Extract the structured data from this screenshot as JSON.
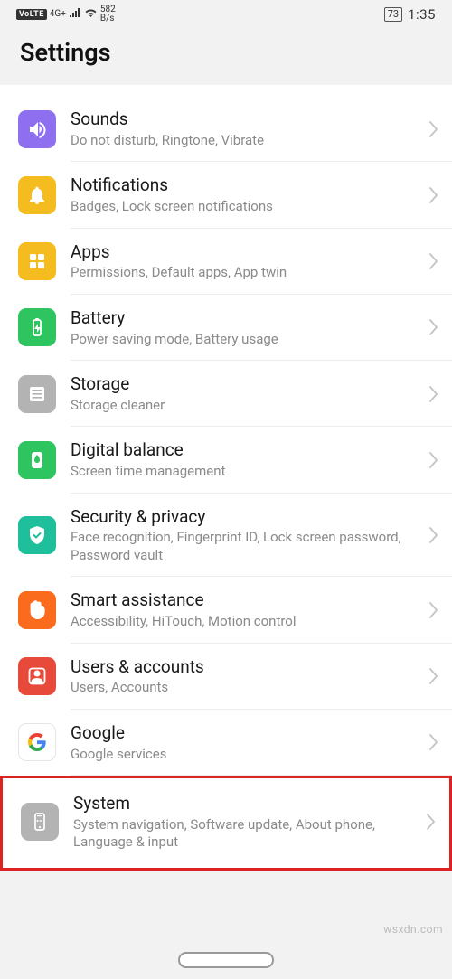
{
  "status": {
    "volte": "VoLTE",
    "network": "4G+",
    "speed_value": "582",
    "speed_unit": "B/s",
    "battery": "73",
    "time": "1:35"
  },
  "header": {
    "title": "Settings"
  },
  "items": [
    {
      "icon": "sounds",
      "icon_cls": "ic-purple",
      "title": "Sounds",
      "subtitle": "Do not disturb, Ringtone, Vibrate"
    },
    {
      "icon": "notifications",
      "icon_cls": "ic-yellow",
      "title": "Notifications",
      "subtitle": "Badges, Lock screen notifications"
    },
    {
      "icon": "apps",
      "icon_cls": "ic-yellow",
      "title": "Apps",
      "subtitle": "Permissions, Default apps, App twin"
    },
    {
      "icon": "battery",
      "icon_cls": "ic-green",
      "title": "Battery",
      "subtitle": "Power saving mode, Battery usage"
    },
    {
      "icon": "storage",
      "icon_cls": "ic-gray",
      "title": "Storage",
      "subtitle": "Storage cleaner"
    },
    {
      "icon": "digital-balance",
      "icon_cls": "ic-green",
      "title": "Digital balance",
      "subtitle": "Screen time management"
    },
    {
      "icon": "security",
      "icon_cls": "ic-teal",
      "title": "Security & privacy",
      "subtitle": "Face recognition, Fingerprint ID, Lock screen password, Password vault"
    },
    {
      "icon": "smart-assist",
      "icon_cls": "ic-orange",
      "title": "Smart assistance",
      "subtitle": "Accessibility, HiTouch, Motion control"
    },
    {
      "icon": "users",
      "icon_cls": "ic-red",
      "title": "Users & accounts",
      "subtitle": "Users, Accounts"
    },
    {
      "icon": "google",
      "icon_cls": "ic-white",
      "title": "Google",
      "subtitle": "Google services"
    },
    {
      "icon": "system",
      "icon_cls": "ic-gray",
      "title": "System",
      "subtitle": "System navigation, Software update, About phone, Language & input",
      "highlight": true
    }
  ],
  "watermark": "wsxdn.com"
}
